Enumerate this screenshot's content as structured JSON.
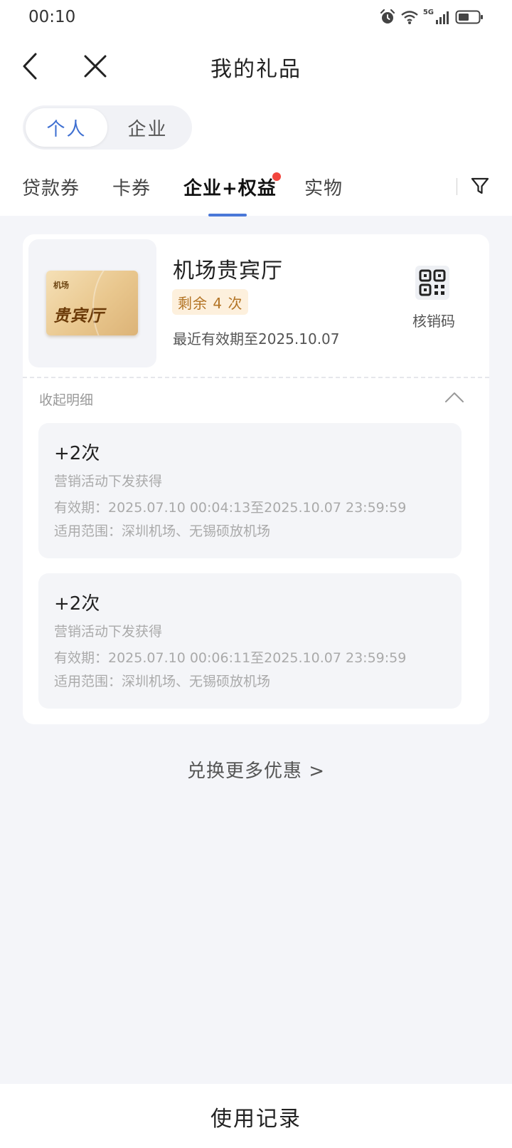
{
  "status_bar": {
    "time": "00:10",
    "network": "5G",
    "icons": [
      "alarm-icon",
      "wifi-icon",
      "signal-icon",
      "battery-icon"
    ]
  },
  "nav": {
    "title": "我的礼品",
    "back_icon": "chevron-left-icon",
    "close_icon": "close-icon"
  },
  "segment": {
    "items": [
      {
        "label": "个人",
        "active": true
      },
      {
        "label": "企业",
        "active": false
      }
    ]
  },
  "tabs": {
    "items": [
      {
        "label": "贷款券",
        "active": false
      },
      {
        "label": "卡券",
        "active": false
      },
      {
        "label": "企业+权益",
        "active": true,
        "badge_dot": true
      },
      {
        "label": "实物",
        "active": false
      }
    ],
    "filter_icon": "filter-icon"
  },
  "gift": {
    "card_image": {
      "small_text": "机场",
      "big_text": "贵宾厅"
    },
    "title": "机场贵宾厅",
    "remaining": "剩余 4 次",
    "expiry": "最近有效期至2025.10.07",
    "redeem_label": "核销码",
    "redeem_icon": "qr-code-icon",
    "collapse_label": "收起明细",
    "collapse_icon": "chevron-up-icon",
    "details": [
      {
        "count": "+2次",
        "source": "营销活动下发获得",
        "validity": "有效期：2025.07.10 00:04:13至2025.10.07 23:59:59",
        "scope": "适用范围：深圳机场、无锡硕放机场"
      },
      {
        "count": "+2次",
        "source": "营销活动下发获得",
        "validity": "有效期：2025.07.10 00:06:11至2025.10.07 23:59:59",
        "scope": "适用范围：深圳机场、无锡硕放机场"
      }
    ]
  },
  "more_link": "兑换更多优惠 >",
  "bottom": {
    "button_label": "使用记录"
  },
  "colors": {
    "accent": "#3e6fd1",
    "tab_underline": "#4a78d8",
    "badge_dot": "#f2453d",
    "badge_bg": "#fdf0dd",
    "badge_text": "#b37425",
    "page_bg": "#f4f5f9"
  }
}
